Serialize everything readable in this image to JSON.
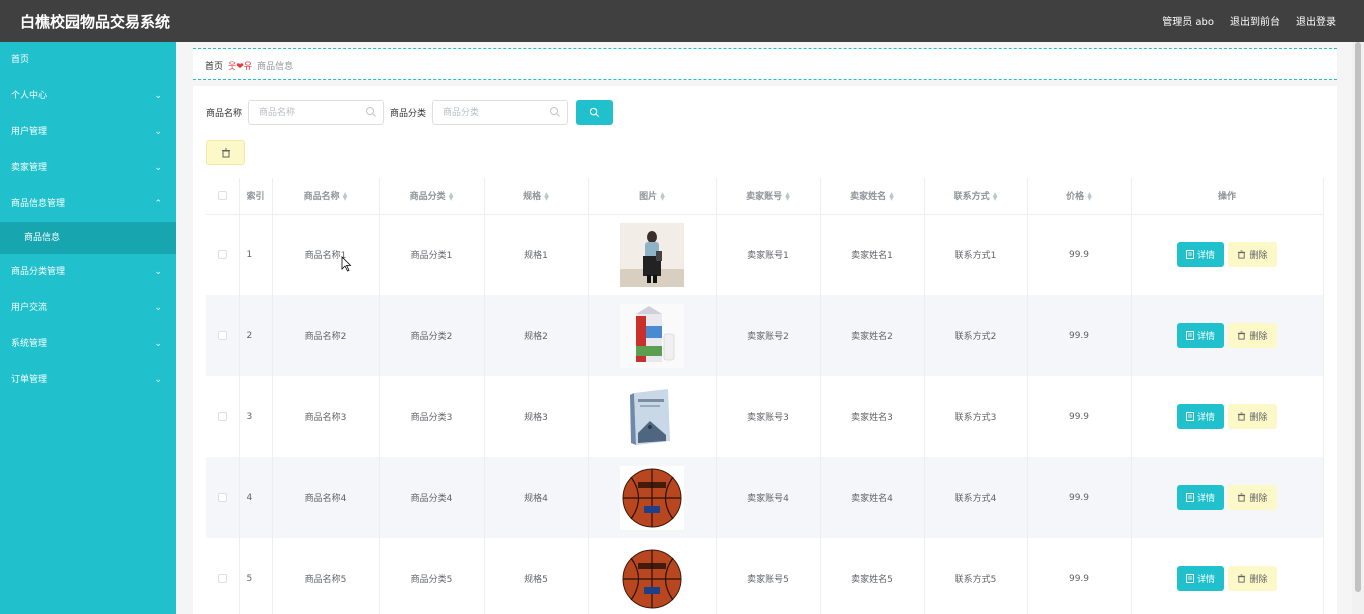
{
  "app": {
    "title": "白樵校园物品交易系统",
    "user": "管理员 abo",
    "back_front": "退出到前台",
    "logout": "退出登录"
  },
  "sidebar": {
    "items": [
      {
        "label": "首页",
        "chevron": ""
      },
      {
        "label": "个人中心",
        "chevron": "chevron-down"
      },
      {
        "label": "用户管理",
        "chevron": "chevron-down"
      },
      {
        "label": "卖家管理",
        "chevron": "chevron-down"
      },
      {
        "label": "商品信息管理",
        "chevron": "chevron-up"
      },
      {
        "label": "商品信息",
        "chevron": ""
      },
      {
        "label": "商品分类管理",
        "chevron": "chevron-down"
      },
      {
        "label": "用户交流",
        "chevron": "chevron-down"
      },
      {
        "label": "系统管理",
        "chevron": "chevron-down"
      },
      {
        "label": "订单管理",
        "chevron": "chevron-down"
      }
    ]
  },
  "breadcrumb": {
    "home": "首页",
    "current": "商品信息"
  },
  "search": {
    "name_label": "商品名称",
    "name_placeholder": "商品名称",
    "category_label": "商品分类",
    "category_placeholder": "商品分类"
  },
  "table": {
    "headers": [
      "索引",
      "商品名称",
      "商品分类",
      "规格",
      "图片",
      "卖家账号",
      "卖家姓名",
      "联系方式",
      "价格",
      "操作"
    ],
    "rows": [
      {
        "index": "1",
        "name": "商品名称1",
        "category": "商品分类1",
        "spec": "规格1",
        "image": "person-photo",
        "account": "卖家账号1",
        "seller": "卖家姓名1",
        "contact": "联系方式1",
        "price": "99.9"
      },
      {
        "index": "2",
        "name": "商品名称2",
        "category": "商品分类2",
        "spec": "规格2",
        "image": "milk-carton-photo",
        "account": "卖家账号2",
        "seller": "卖家姓名2",
        "contact": "联系方式2",
        "price": "99.9"
      },
      {
        "index": "3",
        "name": "商品名称3",
        "category": "商品分类3",
        "spec": "规格3",
        "image": "book-photo",
        "account": "卖家账号3",
        "seller": "卖家姓名3",
        "contact": "联系方式3",
        "price": "99.9"
      },
      {
        "index": "4",
        "name": "商品名称4",
        "category": "商品分类4",
        "spec": "规格4",
        "image": "basketball-photo",
        "account": "卖家账号4",
        "seller": "卖家姓名4",
        "contact": "联系方式4",
        "price": "99.9"
      },
      {
        "index": "5",
        "name": "商品名称5",
        "category": "商品分类5",
        "spec": "规格5",
        "image": "basketball-photo",
        "account": "卖家账号5",
        "seller": "卖家姓名5",
        "contact": "联系方式5",
        "price": "99.9"
      }
    ],
    "detail_label": "详情",
    "delete_label": "删除"
  },
  "colors": {
    "accent": "#20c1cc",
    "topbar": "#404040",
    "warning_bg": "#fdf8c8"
  }
}
